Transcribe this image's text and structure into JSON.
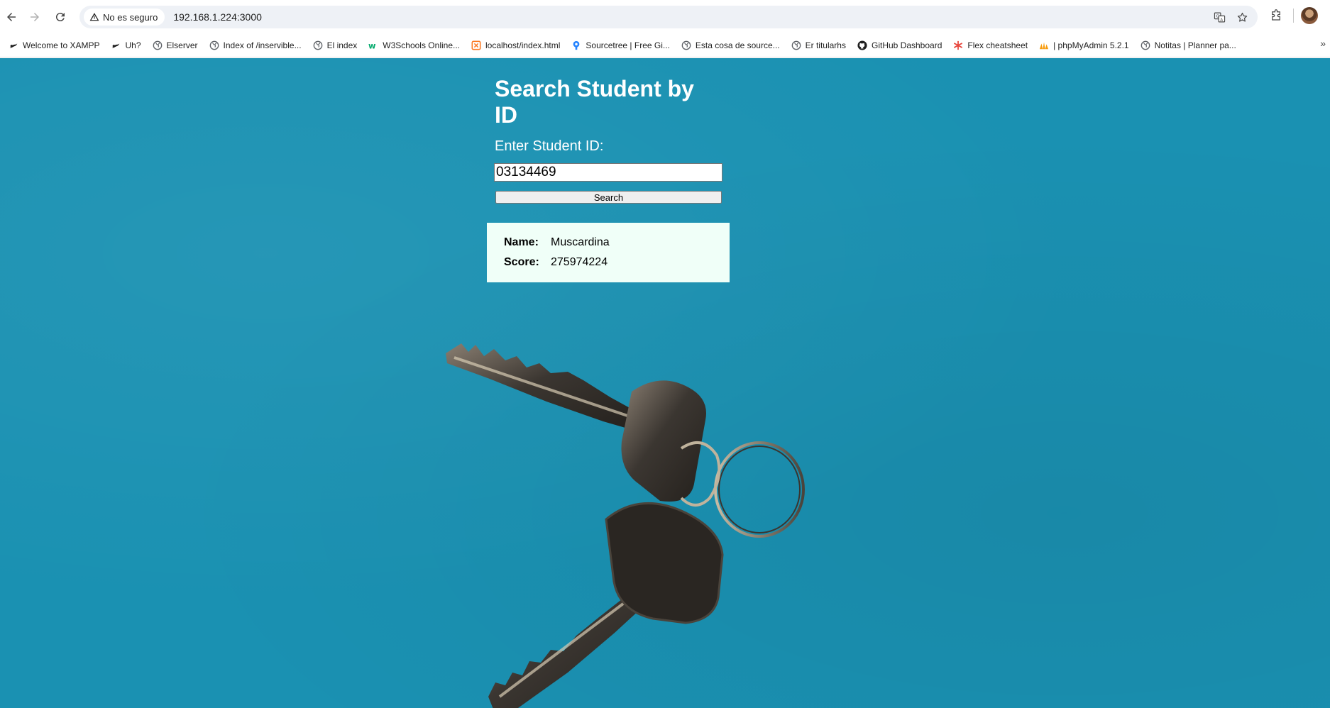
{
  "browser": {
    "security_label": "No es seguro",
    "url": "192.168.1.224:3000",
    "bookmarks": [
      {
        "label": "Welcome to XAMPP",
        "icon": "xampp-icon"
      },
      {
        "label": "Uh?",
        "icon": "xampp-icon"
      },
      {
        "label": "Elserver",
        "icon": "globe-icon"
      },
      {
        "label": "Index of /inservible...",
        "icon": "globe-icon"
      },
      {
        "label": "El index",
        "icon": "globe-icon"
      },
      {
        "label": "W3Schools Online...",
        "icon": "w3schools-icon"
      },
      {
        "label": "localhost/index.html",
        "icon": "xampp-icon"
      },
      {
        "label": "Sourcetree | Free Gi...",
        "icon": "sourcetree-icon"
      },
      {
        "label": "Esta cosa de source...",
        "icon": "globe-icon"
      },
      {
        "label": "Er titularhs",
        "icon": "globe-icon"
      },
      {
        "label": "GitHub Dashboard",
        "icon": "github-icon"
      },
      {
        "label": "Flex cheatsheet",
        "icon": "flex-icon"
      },
      {
        "label": "| phpMyAdmin 5.2.1",
        "icon": "phpmyadmin-icon"
      },
      {
        "label": "Notitas | Planner pa...",
        "icon": "globe-icon"
      }
    ],
    "more_label": "»"
  },
  "page": {
    "title": "Search Student by ID",
    "input_label": "Enter Student ID:",
    "student_id_value": "03134469",
    "search_button": "Search",
    "result": {
      "name_label": "Name:",
      "name_value": "Muscardina",
      "score_label": "Score:",
      "score_value": "275974224"
    }
  },
  "colors": {
    "background": "#1a91b2",
    "result_card": "#f0fff8"
  }
}
